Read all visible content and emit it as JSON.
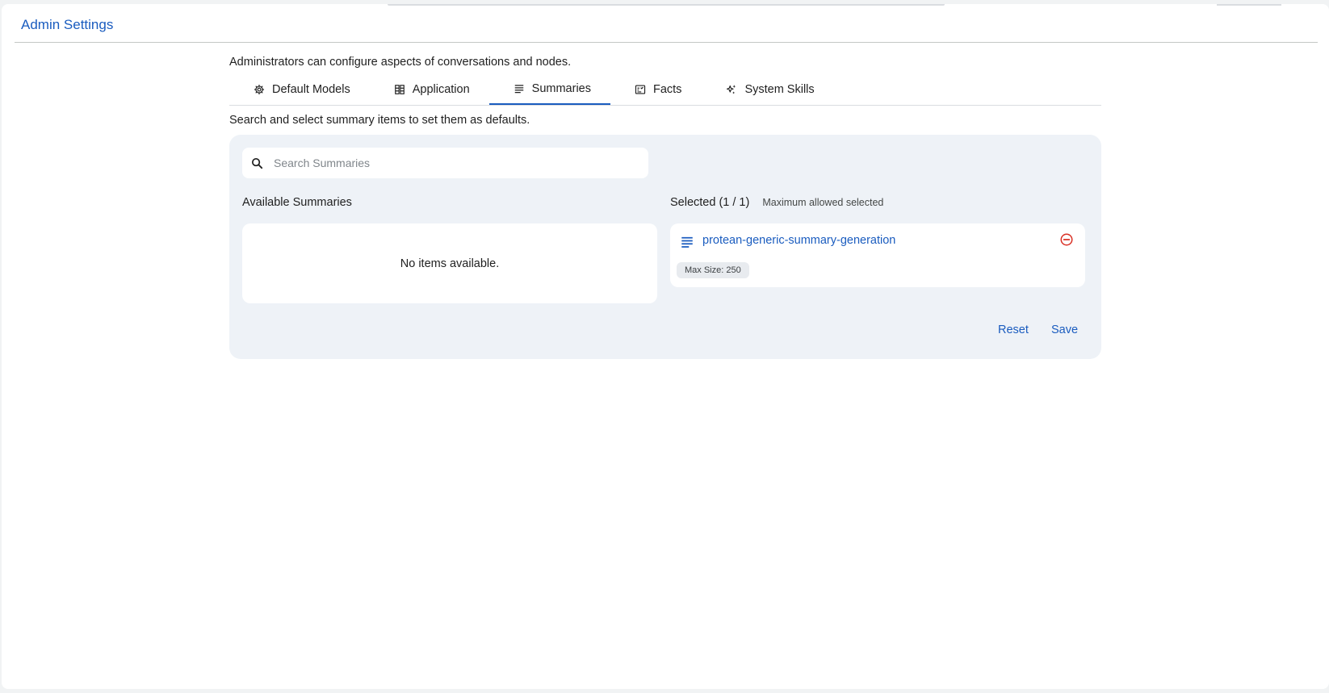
{
  "app": {
    "title": "Admin Settings"
  },
  "intro": "Administrators can configure aspects of conversations and nodes.",
  "tabs": [
    {
      "label": "Default Models",
      "icon": "gear-icon",
      "active": false
    },
    {
      "label": "Application",
      "icon": "app-grid-icon",
      "active": false
    },
    {
      "label": "Summaries",
      "icon": "lines-icon",
      "active": true
    },
    {
      "label": "Facts",
      "icon": "fact-card-icon",
      "active": false
    },
    {
      "label": "System Skills",
      "icon": "sparkle-icon",
      "active": false
    }
  ],
  "instructions": "Search and select summary items to set them as defaults.",
  "search": {
    "placeholder": "Search Summaries",
    "value": ""
  },
  "available": {
    "title": "Available Summaries",
    "empty_text": "No items available."
  },
  "selected": {
    "title": "Selected (1 / 1)",
    "note": "Maximum allowed selected",
    "items": [
      {
        "name": "protean-generic-summary-generation",
        "chip": "Max Size: 250"
      }
    ]
  },
  "actions": {
    "reset": "Reset",
    "save": "Save"
  },
  "colors": {
    "accent": "#1a5cbf",
    "danger": "#d93025",
    "panel": "#eef2f7"
  }
}
